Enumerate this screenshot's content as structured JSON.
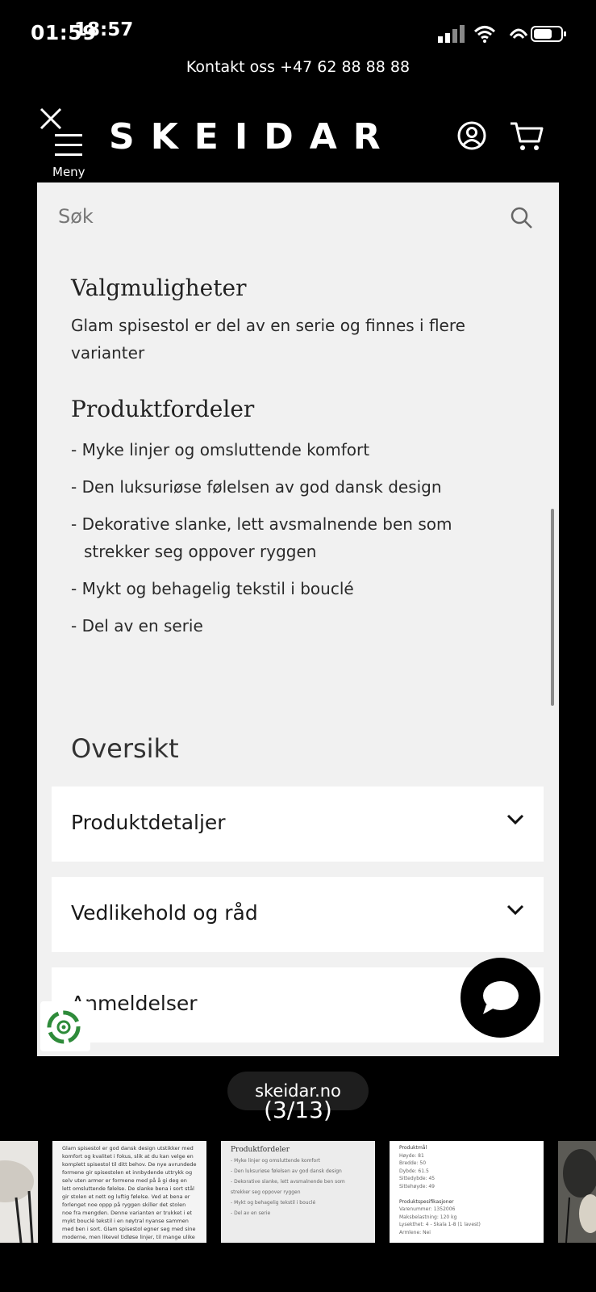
{
  "status": {
    "time": "01:59",
    "time_overlay": "18:57"
  },
  "contact": "Kontakt oss +47 62 88 88 88",
  "header": {
    "menu_label": "Meny",
    "logo": "SKEIDAR"
  },
  "search": {
    "placeholder": "Søk"
  },
  "options": {
    "title": "Valgmuligheter",
    "text": "Glam spisestol er del av en serie og finnes i flere varianter"
  },
  "benefits": {
    "title": "Produktfordeler",
    "items": [
      "- Myke linjer og omsluttende komfort",
      "- Den luksuriøse følelsen av god dansk design",
      "- Dekorative slanke, lett avsmalnende ben som strekker seg oppover ryggen",
      "- Mykt og behagelig tekstil i bouclé",
      "- Del av en serie"
    ]
  },
  "overview": {
    "title": "Oversikt",
    "accordions": [
      "Produktdetaljer",
      "Vedlikehold og råd",
      "Anmeldelser"
    ]
  },
  "viewer": {
    "url": "skeidar.no",
    "counter": "(3/13)"
  },
  "thumbnails": {
    "thumb2_text": "Glam spisestol er god dansk design utstikker med komfort og kvalitet i fokus, slik at du kan velge en komplett spisestol til ditt behov. De nye avrundede formene gir spisestolen et innbydende uttrykk og selv uten armer er formene med på å gi deg en lett omsluttende følelse. De slanke bena i sort stål gir stolen et nett og luftig følelse. Ved at bena er forlenget noe oppp på ryggen skiller det stolen noe fra mengden. Denne varianten er trukket i et mykt bouclé tekstil i en nøytral nyanse sammen med ben i sort. Glam spisestol egner seg med sine moderne, men likevel tidløse linjer, til mange ulike spisebord.",
    "thumb3_title": "Produktfordeler",
    "thumb3_lines": [
      "- Myke linjer og omsluttende komfort",
      "- Den luksuriøse følelsen av god dansk design",
      "- Dekorative slanke, lett avsmalnende ben som",
      "  strekker seg oppover ryggen",
      "- Mykt og behagelig tekstil i bouclé",
      "- Del av en serie"
    ],
    "thumb4_lines": [
      "Produktmål",
      "Høyde: 81",
      "Bredde: 50",
      "Dybde: 61.5",
      "Sittedybde: 45",
      "Sittehøyde: 49",
      "",
      "Produktspesifikasjoner",
      "Varenummer: 1352006",
      "Maksbelastning: 120 kg",
      "Lysekthet: 4 - Skala 1-8 (1 lavest)",
      "Armlene: Nei"
    ]
  },
  "colors": {
    "background": "#000000",
    "panel": "#f1f1f1",
    "card": "#ffffff",
    "eco_green": "#2e8b3a"
  }
}
